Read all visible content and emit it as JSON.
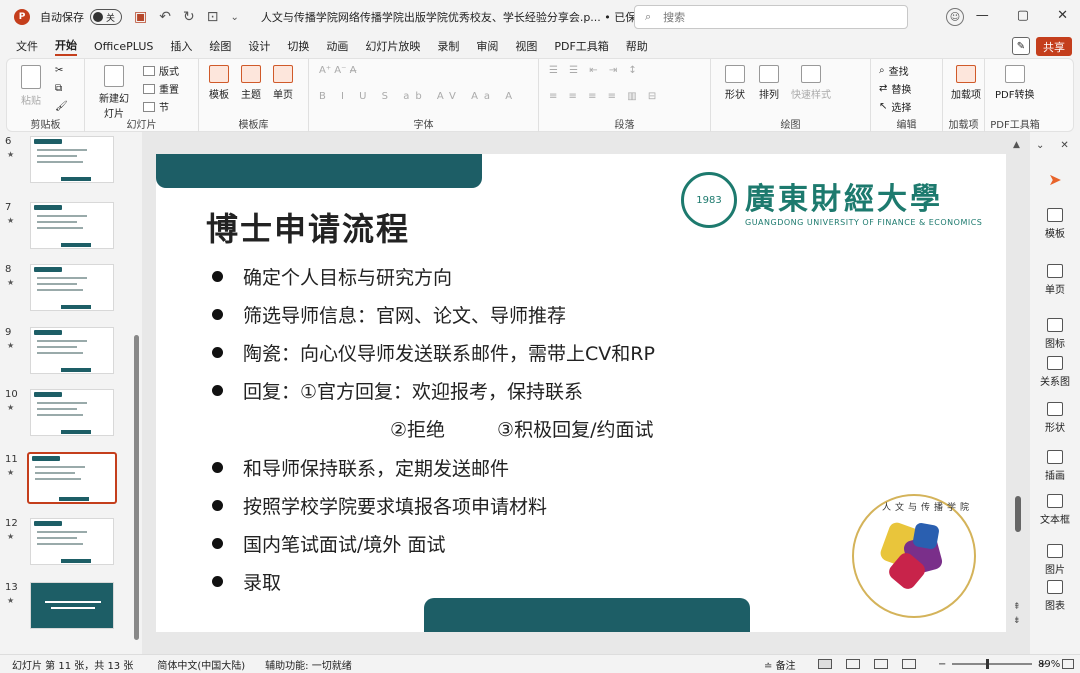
{
  "titlebar": {
    "autosave_label": "自动保存",
    "toggle_state": "关",
    "doc_title": "人文与传播学院网络传播学院出版学院优秀校友、学长经验分享会.p...  • 已保存到这台电脑",
    "search_placeholder": "搜索"
  },
  "menu": [
    "文件",
    "开始",
    "OfficePLUS",
    "插入",
    "绘图",
    "设计",
    "切换",
    "动画",
    "幻灯片放映",
    "录制",
    "审阅",
    "视图",
    "PDF工具箱",
    "帮助"
  ],
  "menu_active": "开始",
  "share_label": "共享",
  "ribbon": {
    "groups": {
      "clipboard": "剪贴板",
      "slides": "幻灯片",
      "template": "模板库",
      "font": "字体",
      "paragraph": "段落",
      "drawing": "绘图",
      "editing": "编辑",
      "addins": "加载项",
      "pdf": "PDF工具箱"
    },
    "buttons": {
      "paste": "粘贴",
      "new_slide": "新建幻灯片",
      "layout": "版式",
      "reset": "重置",
      "section": "节",
      "template": "模板",
      "theme": "主题",
      "single": "单页",
      "shape": "形状",
      "arrange": "排列",
      "quick_style": "快速样式",
      "find": "查找",
      "replace": "替换",
      "select": "选择",
      "addin": "加载项",
      "pdf_convert": "PDF转换"
    }
  },
  "thumbnails": [
    {
      "num": "6"
    },
    {
      "num": "7"
    },
    {
      "num": "8"
    },
    {
      "num": "9"
    },
    {
      "num": "10"
    },
    {
      "num": "11"
    },
    {
      "num": "12"
    },
    {
      "num": "13"
    }
  ],
  "slide": {
    "title": "博士申请流程",
    "logo_cn": "廣東財經大學",
    "logo_en": "GUANGDONG UNIVERSITY OF FINANCE & ECONOMICS",
    "seal_text": "1983",
    "school_seal_text": "人文与传播学院",
    "bullets": [
      "确定个人目标与研究方向",
      "筛选导师信息：官网、论文、导师推荐",
      "陶瓷：向心仪导师发送联系邮件，需带上CV和RP",
      "回复：①官方回复：欢迎报考，保持联系",
      "和导师保持联系，定期发送邮件",
      "按照学校学院要求填报各项申请材料",
      "国内笔试面试/境外 面试",
      "录取"
    ],
    "indent_line": [
      "②拒绝",
      "③积极回复/约面试"
    ]
  },
  "right_panel": [
    "模板",
    "单页",
    "图标",
    "关系图",
    "形状",
    "插画",
    "文本框",
    "图片",
    "图表"
  ],
  "status": {
    "slide_info": "幻灯片 第 11 张，共 13 张",
    "language": "简体中文(中国大陆)",
    "accessibility": "辅助功能: 一切就绪",
    "notes": "备注",
    "zoom": "89%"
  }
}
